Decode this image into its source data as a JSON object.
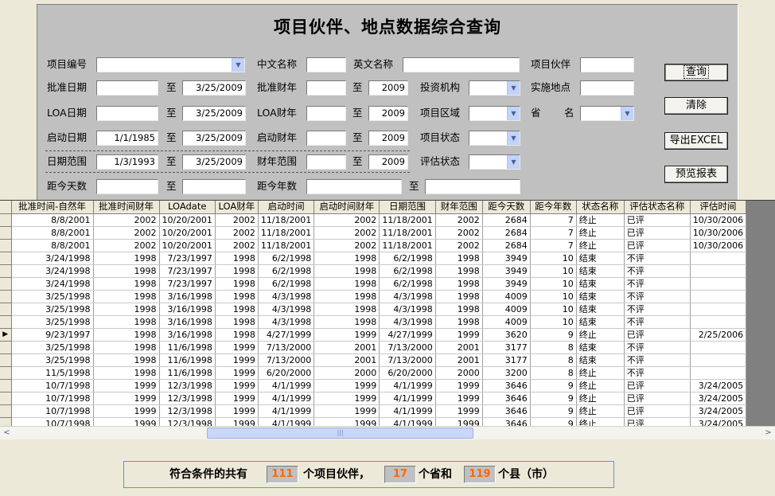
{
  "form": {
    "title": "项目伙伴、地点数据综合查询",
    "labels": {
      "project_no": "项目编号",
      "approve_date": "批准日期",
      "loa_date": "LOA日期",
      "start_date": "启动日期",
      "date_range": "日期范围",
      "days_ago": "距今天数",
      "cn_name": "中文名称",
      "approve_fy": "批准财年",
      "loa_fy": "LOA财年",
      "start_fy": "启动财年",
      "fy_range": "财年范围",
      "years_ago": "距今年数",
      "en_name": "英文名称",
      "investor": "投资机构",
      "project_region": "项目区域",
      "project_status": "项目状态",
      "eval_status": "评估状态",
      "partner": "项目伙伴",
      "site": "实施地点",
      "province_a": "省",
      "province_b": "名",
      "to": "至"
    },
    "values": {
      "approve_date_to": "3/25/2009",
      "loa_date_to": "3/25/2009",
      "start_date_from": "1/1/1985",
      "start_date_to": "3/25/2009",
      "date_range_from": "1/3/1993",
      "date_range_to": "3/25/2009",
      "approve_fy_to": "2009",
      "loa_fy_to": "2009",
      "start_fy_to": "2009",
      "fy_range_to": "2009"
    },
    "buttons": {
      "query": "查询",
      "clear": "清除",
      "export": "导出EXCEL",
      "preview": "预览报表"
    }
  },
  "grid": {
    "columns": [
      "批准时间-自然年",
      "批准时间财年",
      "LOAdate",
      "LOA财年",
      "启动时间",
      "启动时间财年",
      "日期范围",
      "财年范围",
      "距今天数",
      "距今年数",
      "状态名称",
      "评估状态名称",
      "评估时间"
    ],
    "current_row_marker": "▶",
    "rows": [
      [
        "8/8/2001",
        "2002",
        "10/20/2001",
        "2002",
        "11/18/2001",
        "2002",
        "11/18/2001",
        "2002",
        "2684",
        "7",
        "终止",
        "已评",
        "10/30/2006"
      ],
      [
        "8/8/2001",
        "2002",
        "10/20/2001",
        "2002",
        "11/18/2001",
        "2002",
        "11/18/2001",
        "2002",
        "2684",
        "7",
        "终止",
        "已评",
        "10/30/2006"
      ],
      [
        "8/8/2001",
        "2002",
        "10/20/2001",
        "2002",
        "11/18/2001",
        "2002",
        "11/18/2001",
        "2002",
        "2684",
        "7",
        "终止",
        "已评",
        "10/30/2006"
      ],
      [
        "3/24/1998",
        "1998",
        "7/23/1997",
        "1998",
        "6/2/1998",
        "1998",
        "6/2/1998",
        "1998",
        "3949",
        "10",
        "结束",
        "不评",
        ""
      ],
      [
        "3/24/1998",
        "1998",
        "7/23/1997",
        "1998",
        "6/2/1998",
        "1998",
        "6/2/1998",
        "1998",
        "3949",
        "10",
        "结束",
        "不评",
        ""
      ],
      [
        "3/24/1998",
        "1998",
        "7/23/1997",
        "1998",
        "6/2/1998",
        "1998",
        "6/2/1998",
        "1998",
        "3949",
        "10",
        "结束",
        "不评",
        ""
      ],
      [
        "3/25/1998",
        "1998",
        "3/16/1998",
        "1998",
        "4/3/1998",
        "1998",
        "4/3/1998",
        "1998",
        "4009",
        "10",
        "结束",
        "不评",
        ""
      ],
      [
        "3/25/1998",
        "1998",
        "3/16/1998",
        "1998",
        "4/3/1998",
        "1998",
        "4/3/1998",
        "1998",
        "4009",
        "10",
        "结束",
        "不评",
        ""
      ],
      [
        "3/25/1998",
        "1998",
        "3/16/1998",
        "1998",
        "4/3/1998",
        "1998",
        "4/3/1998",
        "1998",
        "4009",
        "10",
        "结束",
        "不评",
        ""
      ],
      [
        "9/23/1997",
        "1998",
        "3/16/1998",
        "1998",
        "4/27/1999",
        "1999",
        "4/27/1999",
        "1999",
        "3620",
        "9",
        "终止",
        "已评",
        "2/25/2006"
      ],
      [
        "3/25/1998",
        "1998",
        "11/6/1998",
        "1999",
        "7/13/2000",
        "2001",
        "7/13/2000",
        "2001",
        "3177",
        "8",
        "结束",
        "不评",
        ""
      ],
      [
        "3/25/1998",
        "1998",
        "11/6/1998",
        "1999",
        "7/13/2000",
        "2001",
        "7/13/2000",
        "2001",
        "3177",
        "8",
        "结束",
        "不评",
        ""
      ],
      [
        "11/5/1998",
        "1998",
        "11/6/1998",
        "1999",
        "6/20/2000",
        "2000",
        "6/20/2000",
        "2000",
        "3200",
        "8",
        "终止",
        "不评",
        ""
      ],
      [
        "10/7/1998",
        "1999",
        "12/3/1998",
        "1999",
        "4/1/1999",
        "1999",
        "4/1/1999",
        "1999",
        "3646",
        "9",
        "终止",
        "已评",
        "3/24/2005"
      ],
      [
        "10/7/1998",
        "1999",
        "12/3/1998",
        "1999",
        "4/1/1999",
        "1999",
        "4/1/1999",
        "1999",
        "3646",
        "9",
        "终止",
        "已评",
        "3/24/2005"
      ],
      [
        "10/7/1998",
        "1999",
        "12/3/1998",
        "1999",
        "4/1/1999",
        "1999",
        "4/1/1999",
        "1999",
        "3646",
        "9",
        "终止",
        "已评",
        "3/24/2005"
      ],
      [
        "10/7/1998",
        "1999",
        "12/3/1998",
        "1999",
        "4/1/1999",
        "1999",
        "4/1/1999",
        "1999",
        "3646",
        "9",
        "终止",
        "已评",
        "3/24/2005"
      ]
    ]
  },
  "scrollbar": {
    "left_arrow": "<",
    "right_arrow": ">",
    "thumb_grip": "|||"
  },
  "summary": {
    "prefix": "符合条件的共有",
    "partners": "111",
    "partners_unit": "个项目伙伴，",
    "provinces": "17",
    "provinces_unit": "个省和",
    "counties": "119",
    "counties_unit": "个县（市）"
  },
  "colors": {
    "count_text": "#ff6600",
    "panel_bg": "#c0c0c0",
    "window_bg": "#ece9d8"
  }
}
